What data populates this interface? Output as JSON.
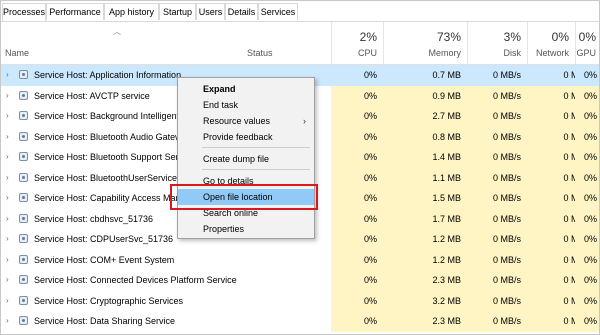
{
  "tabs": [
    "Processes",
    "Performance",
    "App history",
    "Startup",
    "Users",
    "Details",
    "Services"
  ],
  "header": {
    "name": "Name",
    "status": "Status",
    "cpu": {
      "pct": "2%",
      "label": "CPU"
    },
    "memory": {
      "pct": "73%",
      "label": "Memory"
    },
    "disk": {
      "pct": "3%",
      "label": "Disk"
    },
    "network": {
      "pct": "0%",
      "label": "Network"
    },
    "gpu": {
      "pct": "0%",
      "label": "GPU"
    }
  },
  "rows": [
    {
      "name": "Service Host: Application Information",
      "cpu": "0%",
      "mem": "0.7 MB",
      "disk": "0 MB/s",
      "net": "0 Mbps",
      "gpu": "0%"
    },
    {
      "name": "Service Host: AVCTP service",
      "cpu": "0%",
      "mem": "0.9 MB",
      "disk": "0 MB/s",
      "net": "0 Mbps",
      "gpu": "0%"
    },
    {
      "name": "Service Host: Background Intelligent",
      "cpu": "0%",
      "mem": "2.7 MB",
      "disk": "0 MB/s",
      "net": "0 Mbps",
      "gpu": "0%"
    },
    {
      "name": "Service Host: Bluetooth Audio Gatew",
      "cpu": "0%",
      "mem": "0.8 MB",
      "disk": "0 MB/s",
      "net": "0 Mbps",
      "gpu": "0%"
    },
    {
      "name": "Service Host: Bluetooth Support Serv",
      "cpu": "0%",
      "mem": "1.4 MB",
      "disk": "0 MB/s",
      "net": "0 Mbps",
      "gpu": "0%"
    },
    {
      "name": "Service Host: BluetoothUserService_5",
      "cpu": "0%",
      "mem": "1.1 MB",
      "disk": "0 MB/s",
      "net": "0 Mbps",
      "gpu": "0%"
    },
    {
      "name": "Service Host: Capability Access Man",
      "cpu": "0%",
      "mem": "1.5 MB",
      "disk": "0 MB/s",
      "net": "0 Mbps",
      "gpu": "0%"
    },
    {
      "name": "Service Host: cbdhsvc_51736",
      "cpu": "0%",
      "mem": "1.7 MB",
      "disk": "0 MB/s",
      "net": "0 Mbps",
      "gpu": "0%"
    },
    {
      "name": "Service Host: CDPUserSvc_51736",
      "cpu": "0%",
      "mem": "1.2 MB",
      "disk": "0 MB/s",
      "net": "0 Mbps",
      "gpu": "0%"
    },
    {
      "name": "Service Host: COM+ Event System",
      "cpu": "0%",
      "mem": "1.2 MB",
      "disk": "0 MB/s",
      "net": "0 Mbps",
      "gpu": "0%"
    },
    {
      "name": "Service Host: Connected Devices Platform Service",
      "cpu": "0%",
      "mem": "2.3 MB",
      "disk": "0 MB/s",
      "net": "0 Mbps",
      "gpu": "0%"
    },
    {
      "name": "Service Host: Cryptographic Services",
      "cpu": "0%",
      "mem": "3.2 MB",
      "disk": "0 MB/s",
      "net": "0 Mbps",
      "gpu": "0%"
    },
    {
      "name": "Service Host: Data Sharing Service",
      "cpu": "0%",
      "mem": "2.3 MB",
      "disk": "0 MB/s",
      "net": "0 Mbps",
      "gpu": "0%"
    }
  ],
  "menu": {
    "expand": "Expand",
    "end_task": "End task",
    "resource_values": "Resource values",
    "provide_feedback": "Provide feedback",
    "create_dump": "Create dump file",
    "go_to_details": "Go to details",
    "open_file_location": "Open file location",
    "search_online": "Search online",
    "properties": "Properties"
  },
  "colors": {
    "highlight": "#cce8ff",
    "heat": "#fff4c4",
    "menu_hover": "#91c9f7",
    "callout": "#d71920"
  }
}
